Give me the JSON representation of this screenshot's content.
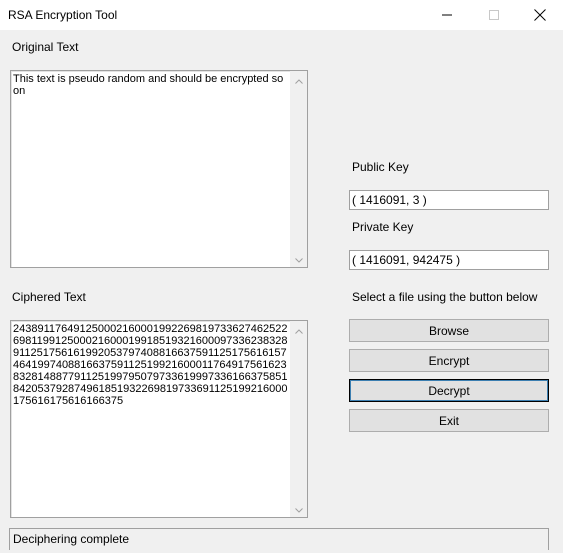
{
  "window": {
    "title": "RSA Encryption Tool",
    "controls": [
      "minimize-icon",
      "maximize-icon",
      "close-icon"
    ]
  },
  "original": {
    "label": "Original Text",
    "text": "This text is pseudo random and should be encrypted soon"
  },
  "ciphered": {
    "label": "Ciphered Text",
    "text": "2438911764912500021600019922698197336274625226981199125000216000199185193216000973362383289112517561619920537974088166375911251756161574641997408816637591125199216000117649175616238328148877911251997950797336199973361663758518420537928749618519322698197336911251992160001756161756161663​75"
  },
  "keys": {
    "public_label": "Public Key",
    "public_value": "( 1416091, 3 )",
    "private_label": "Private Key",
    "private_value": "( 1416091, 942475 )"
  },
  "file": {
    "instruction": "Select a file using the button below"
  },
  "buttons": {
    "browse": "Browse",
    "encrypt": "Encrypt",
    "decrypt": "Decrypt",
    "exit": "Exit"
  },
  "status": {
    "text": "Deciphering complete"
  }
}
